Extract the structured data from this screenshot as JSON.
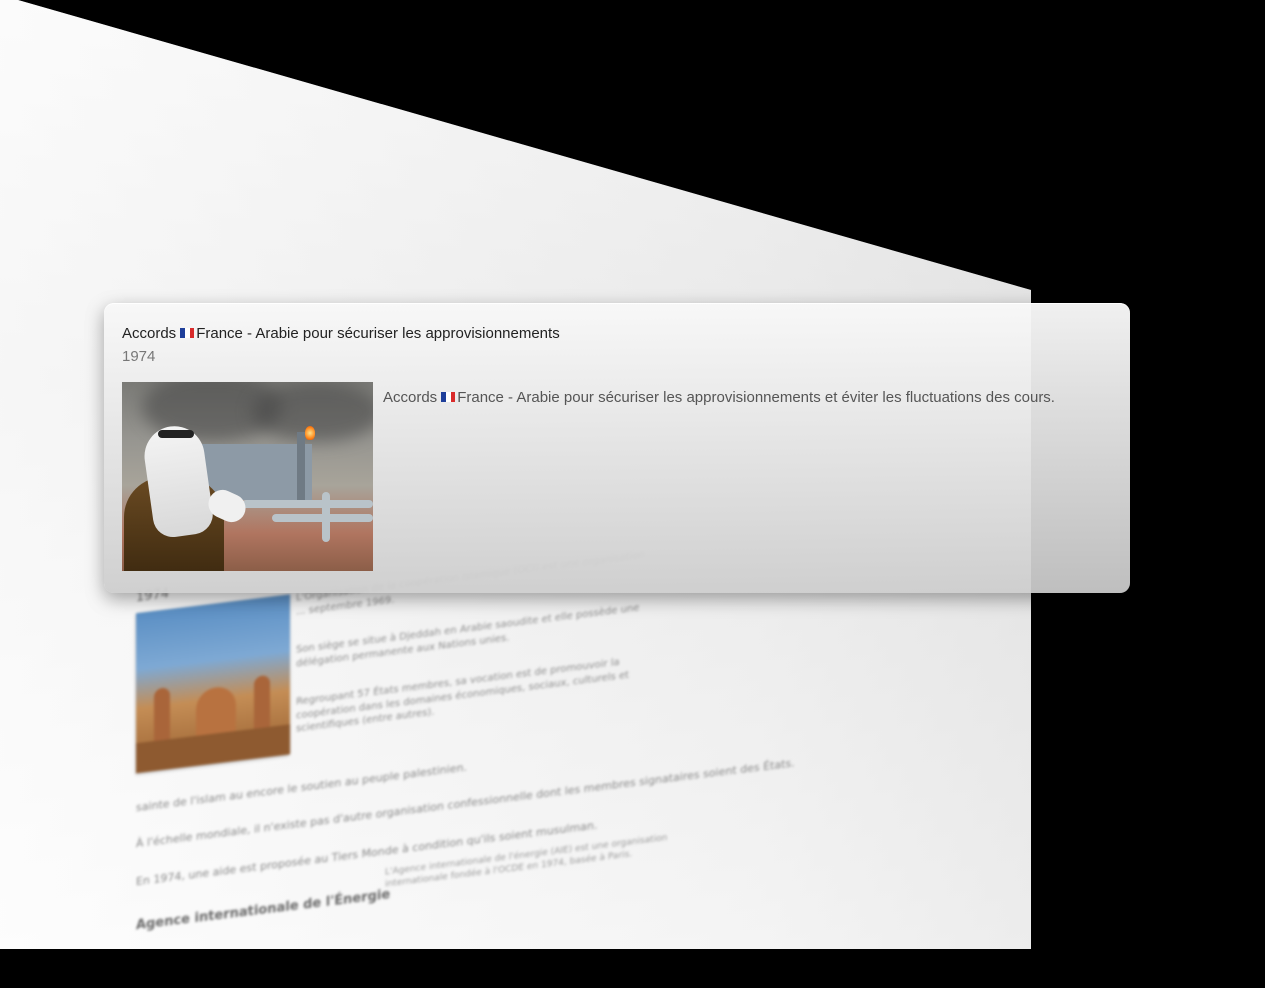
{
  "card": {
    "title_pre": "Accords",
    "title_post": "France - Arabie pour sécuriser les approvisionnements",
    "year": "1974",
    "desc_pre": "Accords",
    "desc_post": "France - Arabie pour sécuriser les approvisionnements et éviter les fluctuations des cours.",
    "flag_icon": "french-flag-icon",
    "image_subject": "oil-refinery-with-arab-man"
  },
  "background": {
    "year": "1974",
    "para1": "L'Organisation de la coopération islamique (OCI) est une organisation ... septembre 1969.",
    "para2": "Son siège se situe à Djeddah en Arabie saoudite et elle possède une délégation permanente aux Nations unies.",
    "para3": "Regroupant 57 États membres, sa vocation est de promouvoir la coopération dans les domaines économiques, sociaux, culturels et scientifiques (entre autres).",
    "line1": "sainte de l'islam au encore le soutien au peuple palestinien.",
    "line2": "À l'échelle mondiale, il n'existe pas d'autre organisation confessionnelle dont les membres signataires soient des États.",
    "line3": "En 1974, une aide est proposée au Tiers Monde à condition qu'ils soient musulman.",
    "heading": "Agence internationale de l'Énergie",
    "right1": "L'Agence internationale de l'énergie (AIE) est une organisation internationale fondée à l'OCDE en 1974, basée à Paris."
  }
}
